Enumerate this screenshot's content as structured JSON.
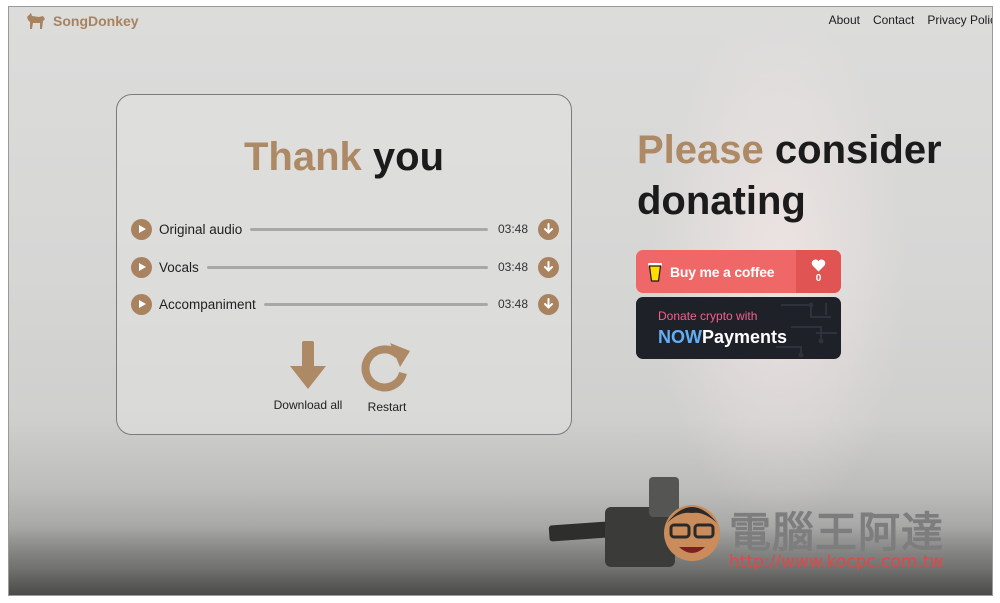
{
  "brand": {
    "name": "SongDonkey",
    "color": "#a9825f"
  },
  "nav": {
    "about": "About",
    "contact": "Contact",
    "privacy": "Privacy Polic"
  },
  "card": {
    "title_part1": "Thank",
    "title_part2": "you",
    "tracks": [
      {
        "name": "Original audio",
        "duration": "03:48"
      },
      {
        "name": "Vocals",
        "duration": "03:48"
      },
      {
        "name": "Accompaniment",
        "duration": "03:48"
      }
    ],
    "download_all_label": "Download all",
    "restart_label": "Restart"
  },
  "donate": {
    "title_part1": "Please",
    "title_part2": "consider",
    "title_part3": "donating",
    "coffee_label": "Buy me a coffee",
    "coffee_count": "0",
    "crypto_line1": "Donate crypto with",
    "crypto_brand_now": "NOW",
    "crypto_brand_payments": "Payments"
  },
  "watermark": {
    "text": "電腦王阿達",
    "url": "http://www.kocpc.com.tw"
  },
  "colors": {
    "accent": "#ae8966",
    "coffee": "#f06767",
    "crypto_bg": "#1f2128",
    "crypto_pink": "#f4608e",
    "crypto_blue": "#62aef7"
  }
}
